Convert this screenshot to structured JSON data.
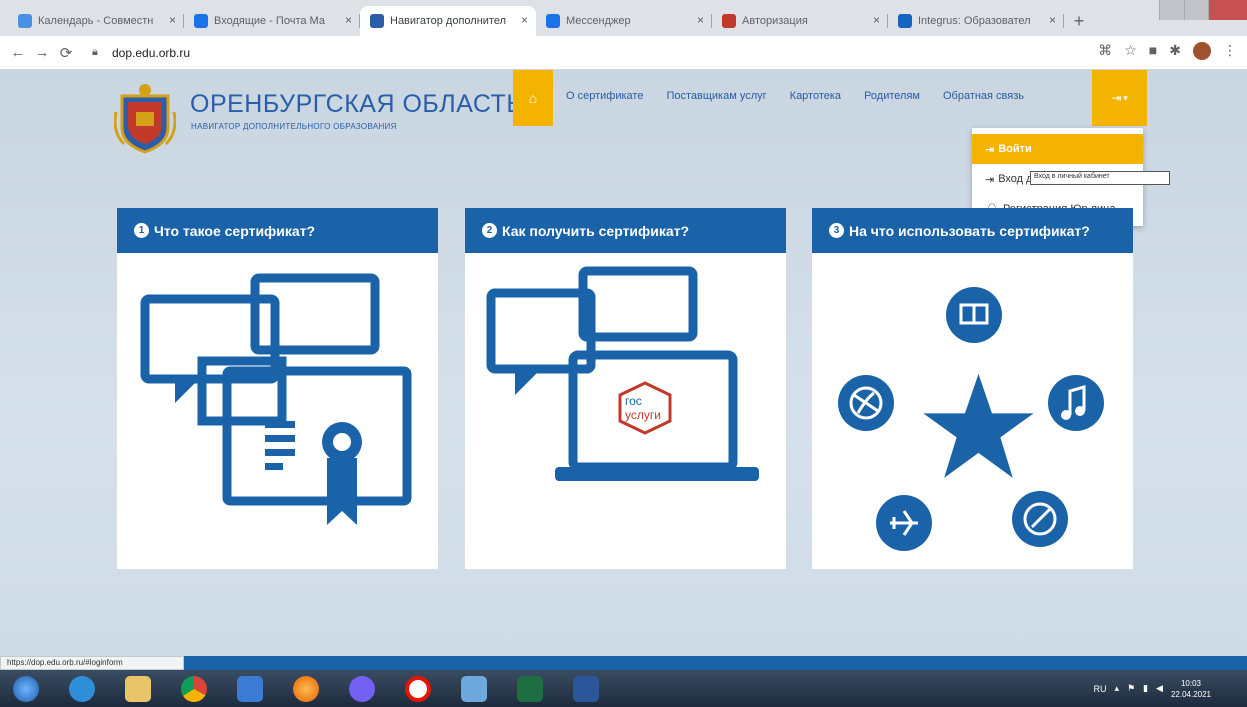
{
  "browser": {
    "tabs": [
      {
        "label": "Календарь - Совместн",
        "active": false,
        "fav_color": "#4a90e2"
      },
      {
        "label": "Входящие - Почта Ма",
        "active": false,
        "fav_color": "#1a73e8"
      },
      {
        "label": "Навигатор дополнител",
        "active": true,
        "fav_color": "#2a5ea8"
      },
      {
        "label": "Мессенджер",
        "active": false,
        "fav_color": "#1a73e8"
      },
      {
        "label": "Авторизация",
        "active": false,
        "fav_color": "#c0392b"
      },
      {
        "label": "Integrus: Образовател",
        "active": false,
        "fav_color": "#1565c0"
      }
    ],
    "url": "dop.edu.orb.ru",
    "status_url": "https://dop.edu.orb.ru/#loginform"
  },
  "site": {
    "title": "ОРЕНБУРГСКАЯ ОБЛАСТЬ",
    "subtitle": "НАВИГАТОР ДОПОЛНИТЕЛЬНОГО ОБРАЗОВАНИЯ",
    "nav": [
      "О сертификате",
      "Поставщикам услуг",
      "Картотека",
      "Родителям",
      "Обратная связь"
    ],
    "login_caret": "▾"
  },
  "dropdown": {
    "items": [
      "Войти",
      "Вход д",
      "Регистрация Юр.лица"
    ],
    "tooltip": "Вход в личный кабинет"
  },
  "cards": [
    {
      "num": "1",
      "title": "Что такое сертификат?"
    },
    {
      "num": "2",
      "title": "Как получить сертификат?",
      "gos_line1": "гос",
      "gos_line2": "услуги"
    },
    {
      "num": "3",
      "title": "На что использовать сертификат?"
    }
  ],
  "colors": {
    "accent": "#f4b300",
    "brand": "#1a63a8"
  },
  "taskbar": {
    "lang": "RU",
    "time": "10:03",
    "date": "22.04.2021"
  }
}
